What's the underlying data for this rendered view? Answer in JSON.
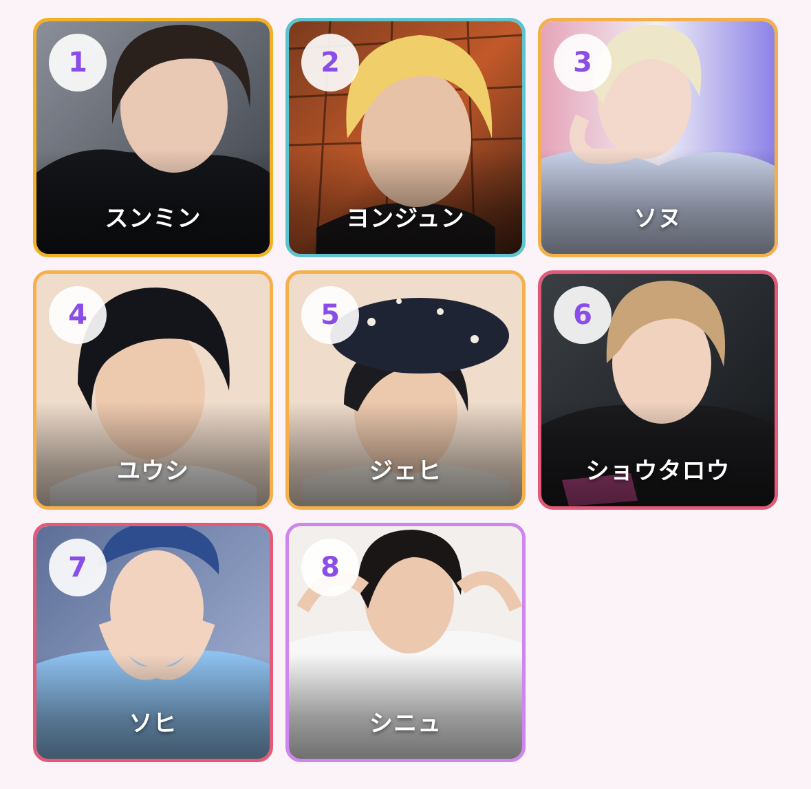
{
  "ranking": {
    "items": [
      {
        "rank": "1",
        "name": "スンミン",
        "border_color": "#f2b124",
        "image": "portrait-dark-hair"
      },
      {
        "rank": "2",
        "name": "ヨンジュン",
        "border_color": "#5ec3cc",
        "image": "portrait-blonde-hair"
      },
      {
        "rank": "3",
        "name": "ソヌ",
        "border_color": "#f4b04d",
        "image": "portrait-platinum-hair"
      },
      {
        "rank": "4",
        "name": "ユウシ",
        "border_color": "#f4b04d",
        "image": "portrait-dark-hair"
      },
      {
        "rank": "5",
        "name": "ジェヒ",
        "border_color": "#f4b04d",
        "image": "portrait-beret"
      },
      {
        "rank": "6",
        "name": "ショウタロウ",
        "border_color": "#e15a78",
        "image": "portrait-light-brown-hair"
      },
      {
        "rank": "7",
        "name": "ソヒ",
        "border_color": "#e15a78",
        "image": "portrait-blue-cap"
      },
      {
        "rank": "8",
        "name": "シニュ",
        "border_color": "#cc86ee",
        "image": "portrait-dark-hair"
      }
    ]
  },
  "colors": {
    "background": "#fbf3f8",
    "rank_badge_text": "#8a4de8",
    "rank_badge_bg": "#ffffff",
    "name_text": "#ffffff"
  }
}
